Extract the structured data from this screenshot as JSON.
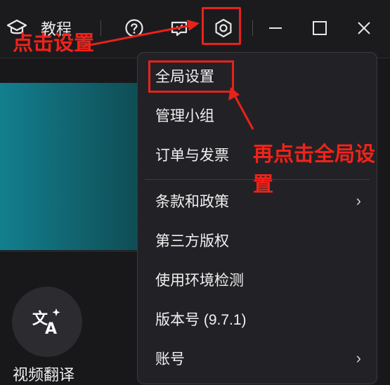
{
  "window": {
    "title": "教程"
  },
  "annotations": {
    "step1": "点击设置",
    "step2_line1": "再点击全局设",
    "step2_line2": "置",
    "color": "#e8221b"
  },
  "feature": {
    "label": "视频翻译",
    "icon": "translate-icon"
  },
  "menu": {
    "items": [
      {
        "label": "全局设置",
        "submenu": false
      },
      {
        "label": "管理小组",
        "submenu": false
      },
      {
        "label": "订单与发票",
        "submenu": false
      },
      {
        "label": "条款和政策",
        "submenu": true
      },
      {
        "label": "第三方版权",
        "submenu": false
      },
      {
        "label": "使用环境检测",
        "submenu": false
      },
      {
        "label": "版本号 (9.7.1)",
        "submenu": false
      },
      {
        "label": "账号",
        "submenu": true
      }
    ]
  },
  "theme": {
    "accent_banner": "#127f8f",
    "background": "#18181b"
  }
}
